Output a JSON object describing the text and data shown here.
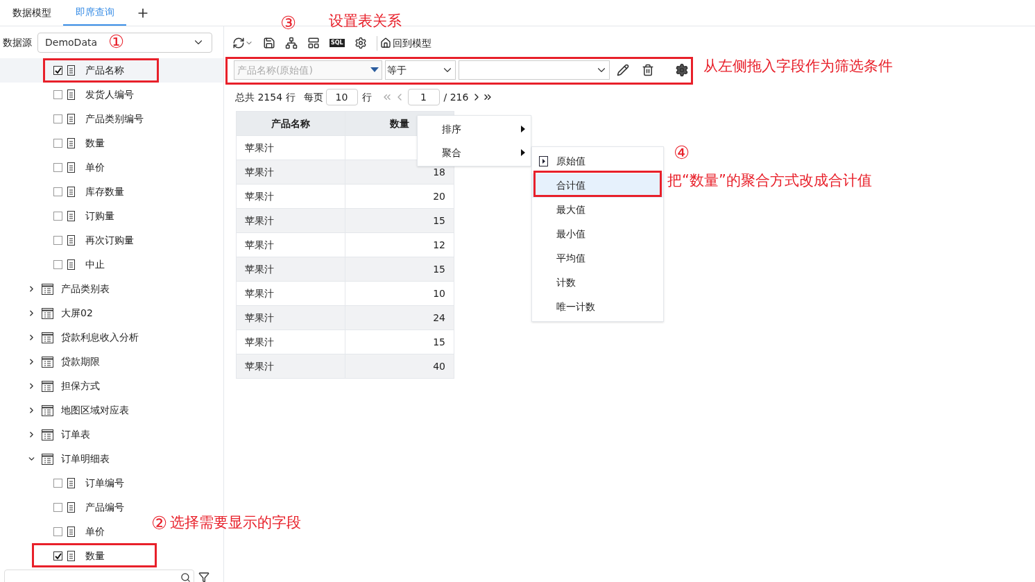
{
  "tabs": [
    {
      "label": "数据模型",
      "selected": false
    },
    {
      "label": "即席查询",
      "selected": true
    }
  ],
  "datasource": {
    "label": "数据源",
    "value": "DemoData"
  },
  "tree": {
    "fields": [
      {
        "label": "产品名称",
        "checked": true,
        "selected": true
      },
      {
        "label": "发货人编号",
        "checked": false,
        "selected": false
      },
      {
        "label": "产品类别编号",
        "checked": false,
        "selected": false
      },
      {
        "label": "数量",
        "checked": false,
        "selected": false
      },
      {
        "label": "单价",
        "checked": false,
        "selected": false
      },
      {
        "label": "库存数量",
        "checked": false,
        "selected": false
      },
      {
        "label": "订购量",
        "checked": false,
        "selected": false
      },
      {
        "label": "再次订购量",
        "checked": false,
        "selected": false
      },
      {
        "label": "中止",
        "checked": false,
        "selected": false
      }
    ],
    "tables": [
      {
        "label": "产品类别表",
        "expanded": false
      },
      {
        "label": "大屏02",
        "expanded": false
      },
      {
        "label": "贷款利息收入分析",
        "expanded": false
      },
      {
        "label": "贷款期限",
        "expanded": false
      },
      {
        "label": "担保方式",
        "expanded": false
      },
      {
        "label": "地图区域对应表",
        "expanded": false
      },
      {
        "label": "订单表",
        "expanded": false
      },
      {
        "label": "订单明细表",
        "expanded": true,
        "children": [
          {
            "label": "订单编号",
            "checked": false,
            "selected": false
          },
          {
            "label": "产品编号",
            "checked": false,
            "selected": false
          },
          {
            "label": "单价",
            "checked": false,
            "selected": false
          },
          {
            "label": "数量",
            "checked": true,
            "selected": false
          }
        ]
      }
    ]
  },
  "toolbar": {
    "sql_label": "SQL",
    "back_label": "回到模型"
  },
  "filter": {
    "field_placeholder": "产品名称(原始值)",
    "operator": "等于"
  },
  "pagination": {
    "total": "总共 2154 行",
    "per_page_label": "每页",
    "per_page": "10",
    "rows_unit": "行",
    "page": "1",
    "pages": "/ 216"
  },
  "table": {
    "columns": [
      "产品名称",
      "数量"
    ],
    "rows": [
      {
        "name": "苹果汁"
      },
      {
        "name": "苹果汁",
        "quantity": "18"
      },
      {
        "name": "苹果汁",
        "quantity": "20"
      },
      {
        "name": "苹果汁",
        "quantity": "15"
      },
      {
        "name": "苹果汁",
        "quantity": "12"
      },
      {
        "name": "苹果汁",
        "quantity": "15"
      },
      {
        "name": "苹果汁",
        "quantity": "10"
      },
      {
        "name": "苹果汁",
        "quantity": "24"
      },
      {
        "name": "苹果汁",
        "quantity": "15"
      },
      {
        "name": "苹果汁",
        "quantity": "40"
      }
    ]
  },
  "context_menu": [
    {
      "label": "排序"
    },
    {
      "label": "聚合"
    }
  ],
  "submenu": [
    {
      "label": "原始值",
      "current": true,
      "selected": false
    },
    {
      "label": "合计值",
      "current": false,
      "selected": true
    },
    {
      "label": "最大值",
      "current": false,
      "selected": false
    },
    {
      "label": "最小值",
      "current": false,
      "selected": false
    },
    {
      "label": "平均值",
      "current": false,
      "selected": false
    },
    {
      "label": "计数",
      "current": false,
      "selected": false
    },
    {
      "label": "唯一计数",
      "current": false,
      "selected": false
    }
  ],
  "annotations": [
    {
      "number": "③"
    },
    {
      "text": "设置表关系"
    },
    {
      "number": "①"
    },
    {
      "text": "从左侧拖入字段作为筛选条件"
    },
    {
      "number": "④"
    },
    {
      "text": "把“数量”的聚合方式改成合计值"
    },
    {
      "number": "②",
      "text": "选择需要显示的字段"
    }
  ]
}
